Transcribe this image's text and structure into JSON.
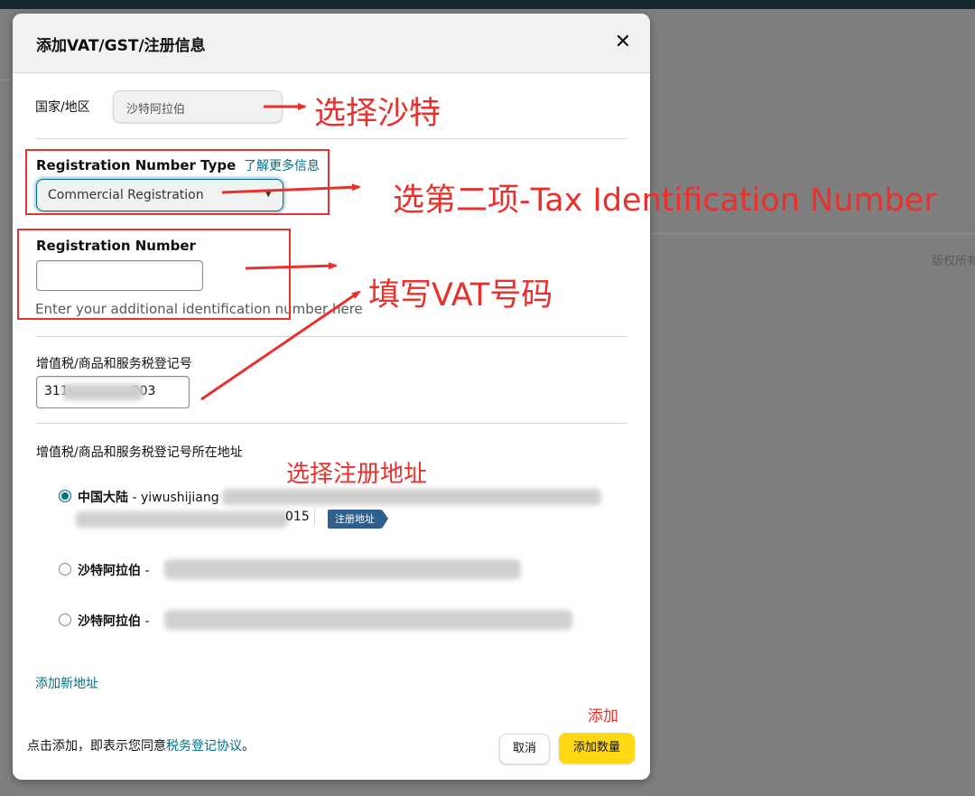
{
  "background": {
    "copyright_text": "版权所有"
  },
  "modal": {
    "title": "添加VAT/GST/注册信息",
    "close_symbol": "✕",
    "country": {
      "label": "国家/地区",
      "value": "沙特阿拉伯"
    },
    "registration_type": {
      "label": "Registration Number Type",
      "learn_more": "了解更多信息",
      "selected": "Commercial Registration"
    },
    "registration_number": {
      "label": "Registration Number",
      "value": "",
      "helper": "Enter your additional identification number here"
    },
    "vat": {
      "label": "增值税/商品和服务税登记号",
      "value": "311          003"
    },
    "address_section": {
      "label": "增值税/商品和服务税登记号所在地址",
      "options": [
        {
          "country": "中国大陆",
          "line1_prefix": " - yiwushijiang",
          "line2_suffix": "015",
          "selected": true,
          "tag": "注册地址"
        },
        {
          "country": "沙特阿拉伯",
          "line1_prefix": " - ",
          "selected": false
        },
        {
          "country": "沙特阿拉伯",
          "line1_prefix": " - ",
          "selected": false
        }
      ],
      "add_new": "添加新地址"
    },
    "footer": {
      "agree_prefix": "点击添加，即表示您同意",
      "agreement_link": "税务登记协议",
      "agree_suffix": "。",
      "cancel": "取消",
      "add": "添加数量"
    }
  },
  "annotations": {
    "select_saudi": "选择沙特",
    "select_second_option": "选第二项-Tax Identification Number",
    "fill_vat": "填写VAT号码",
    "select_address": "选择注册地址",
    "add": "添加"
  },
  "colors": {
    "annotation": "#e8312c",
    "link": "#007185",
    "primary_button": "#ffd814",
    "header_bg": "#f0f2f2"
  }
}
